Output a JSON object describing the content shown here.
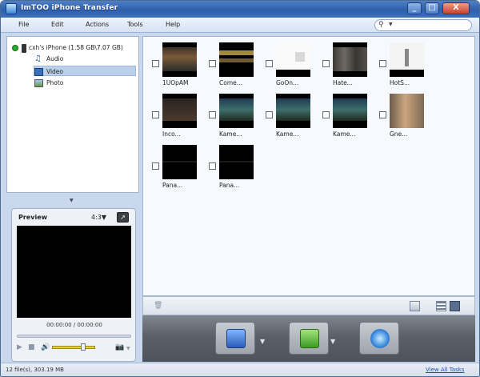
{
  "window": {
    "title": "ImTOO iPhone Transfer",
    "minimize": "_",
    "maximize": "□",
    "close": "X"
  },
  "menu": {
    "file": "File",
    "edit": "Edit",
    "actions": "Actions",
    "tools": "Tools",
    "help": "Help"
  },
  "search": {
    "icon": "search-icon",
    "placeholder": ""
  },
  "tree": {
    "device": "cxh's iPhone (1.58 GB\\7.07 GB)",
    "items": [
      {
        "label": "Audio",
        "icon": "music-note-icon"
      },
      {
        "label": "Video",
        "icon": "film-icon",
        "selected": true
      },
      {
        "label": "Photo",
        "icon": "photo-icon"
      }
    ]
  },
  "preview": {
    "title": "Preview",
    "ratio": "4:3",
    "time": "00:00:00 / 00:00:00",
    "volume_fraction": 0.7
  },
  "videos": [
    {
      "label": "1UOpAM"
    },
    {
      "label": "Come..."
    },
    {
      "label": "GoOn..."
    },
    {
      "label": "Hate..."
    },
    {
      "label": "HotS..."
    },
    {
      "label": "Inco..."
    },
    {
      "label": "Kame..."
    },
    {
      "label": "Kame..."
    },
    {
      "label": "Kame..."
    },
    {
      "label": "Gne..."
    },
    {
      "label": "Pana..."
    },
    {
      "label": "Pana..."
    }
  ],
  "status": {
    "files": "12 file(s), 303.19 MB",
    "link": "View All Tasks"
  },
  "colors": {
    "titlebar": "#2d5fab",
    "selection": "#bcd0ea",
    "volume": "#e8cf2a"
  }
}
